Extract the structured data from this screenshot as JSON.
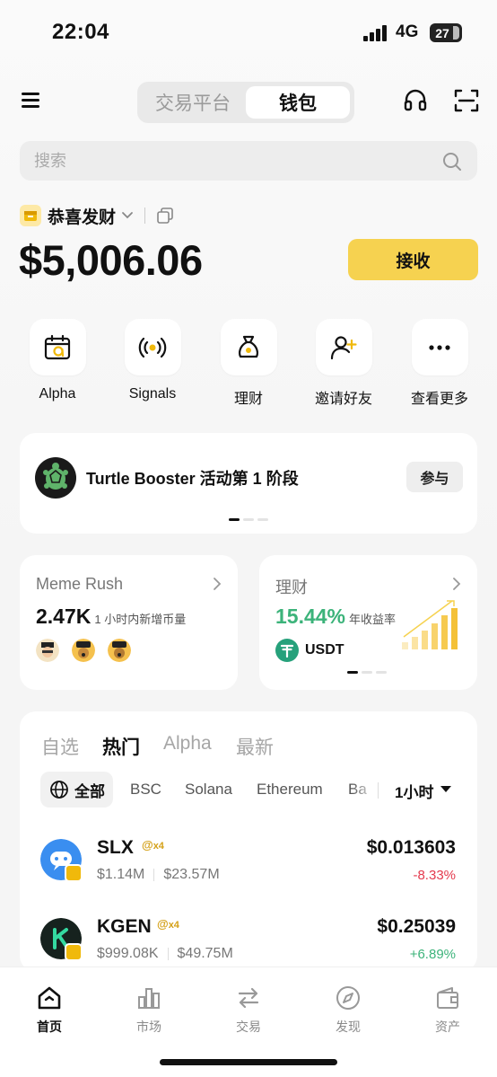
{
  "status_bar": {
    "time": "22:04",
    "network": "4G",
    "battery": "27"
  },
  "header": {
    "tabs": [
      {
        "label": "交易平台",
        "active": false
      },
      {
        "label": "钱包",
        "active": true
      }
    ],
    "menu_icon": "menu-icon",
    "support_icon": "headset-icon",
    "scan_icon": "scan-icon"
  },
  "search": {
    "placeholder": "搜索",
    "value": ""
  },
  "wallet": {
    "name": "恭喜发财",
    "balance": "$5,006.06",
    "receive_label": "接收"
  },
  "quick_actions": [
    {
      "label": "Alpha",
      "icon": "alpha-calendar-icon"
    },
    {
      "label": "Signals",
      "icon": "signals-icon"
    },
    {
      "label": "理财",
      "icon": "money-bag-icon"
    },
    {
      "label": "邀请好友",
      "icon": "invite-user-icon"
    },
    {
      "label": "查看更多",
      "icon": "more-icon"
    }
  ],
  "promo": {
    "title": "Turtle Booster 活动第 1 阶段",
    "button": "参与",
    "pages": 3,
    "active_page": 1
  },
  "meme_rush": {
    "title": "Meme Rush",
    "value": "2.47K",
    "subtitle": "1 小时内新增币量"
  },
  "earn": {
    "title": "理财",
    "rate": "15.44%",
    "rate_label": "年收益率",
    "asset": "USDT",
    "accent": "#3cb37a"
  },
  "markets": {
    "tabs": [
      {
        "label": "自选",
        "active": false
      },
      {
        "label": "热门",
        "active": true
      },
      {
        "label": "Alpha",
        "active": false
      },
      {
        "label": "最新",
        "active": false
      }
    ],
    "chains": [
      "全部",
      "BSC",
      "Solana",
      "Ethereum",
      "Ba"
    ],
    "timeframe": "1小时",
    "tokens": [
      {
        "symbol": "SLX",
        "alpha": "x4",
        "market_cap": "$1.14M",
        "volume": "$23.57M",
        "price": "$0.013603",
        "change": "-8.33%",
        "change_color": "#e4394d"
      },
      {
        "symbol": "KGEN",
        "alpha": "x4",
        "market_cap": "$999.08K",
        "volume": "$49.75M",
        "price": "$0.25039",
        "change": "+6.89%",
        "change_color": "#3cb37a"
      }
    ]
  },
  "bottom_nav": [
    {
      "label": "首页",
      "icon": "home-icon",
      "active": true
    },
    {
      "label": "市场",
      "icon": "market-chart-icon",
      "active": false
    },
    {
      "label": "交易",
      "icon": "trade-arrows-icon",
      "active": false
    },
    {
      "label": "发现",
      "icon": "compass-icon",
      "active": false
    },
    {
      "label": "资产",
      "icon": "wallet-icon",
      "active": false
    }
  ]
}
